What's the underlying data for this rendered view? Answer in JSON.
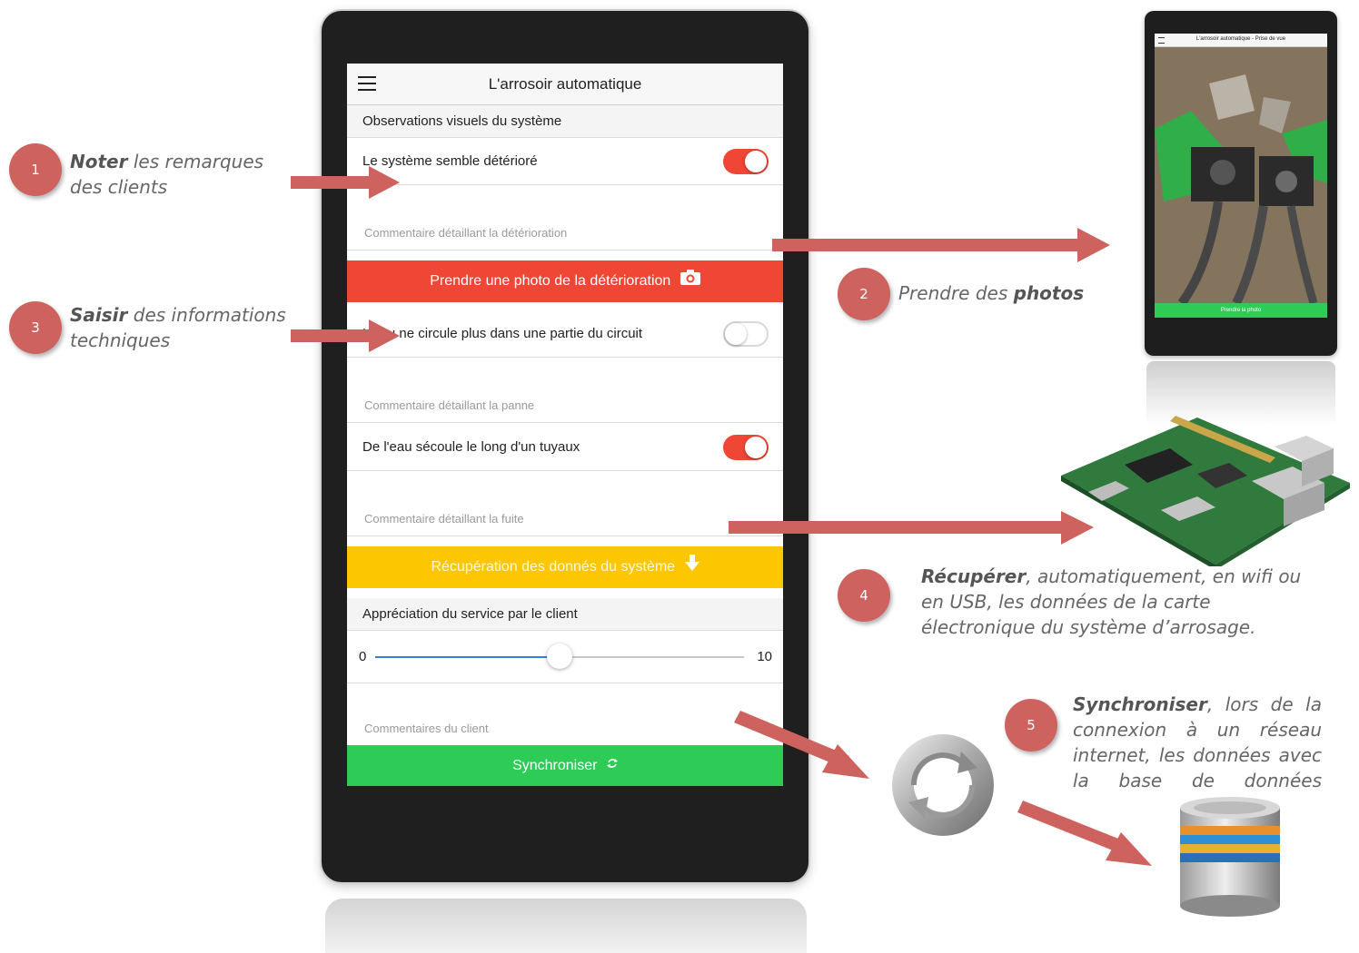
{
  "app": {
    "title": "L'arrosoir automatique",
    "section_visual": "Observations visuels du système",
    "row_deterioration": {
      "label": "Le système semble détérioré",
      "on": true
    },
    "comment_deterioration": {
      "placeholder": "Commentaire détaillant la détérioration"
    },
    "photo_button": "Prendre une photo de la détérioration",
    "row_circuit": {
      "label": "L'eau ne circule plus dans une partie du circuit",
      "on": false
    },
    "comment_panne": {
      "placeholder": "Commentaire détaillant la panne"
    },
    "row_leak": {
      "label": "De l'eau sécoule le long d'un tuyaux",
      "on": true
    },
    "comment_fuite": {
      "placeholder": "Commentaire détaillant la fuite"
    },
    "data_button": "Récupération des donnés du système",
    "section_service": "Appréciation du service par le client",
    "slider": {
      "min": "0",
      "max": "10",
      "value": 5
    },
    "comment_client": {
      "placeholder": "Commentaires du client"
    },
    "sync_button": "Synchroniser"
  },
  "secondary_phone": {
    "title": "L'arrosoir automatique - Prise de vue",
    "button": "Prendre la photo"
  },
  "callouts": [
    {
      "num": "1",
      "bold": "Noter",
      "rest": " les remarques des clients"
    },
    {
      "num": "2",
      "pre": "Prendre des ",
      "bold": "photos"
    },
    {
      "num": "3",
      "bold": "Saisir",
      "rest": " des informations techniques"
    },
    {
      "num": "4",
      "bold": "Récupérer",
      "rest": ", automatiquement, en wifi ou en USB, les données de la carte électronique du système d’arrosage."
    },
    {
      "num": "5",
      "bold": "Synchroniser",
      "rest": ", lors de la connexion à un réseau internet, les données avec la base de données"
    }
  ],
  "colors": {
    "red": "#ef4635",
    "yellow": "#fdc700",
    "green": "#2ecb56",
    "badge": "#cd625e",
    "arrow": "#cd625e",
    "slider": "#3b7ddd"
  },
  "icons": [
    "menu-icon",
    "camera-icon",
    "download-arrow-icon",
    "sync-icon",
    "refresh-globe-icon",
    "database-icon",
    "circuit-board-icon"
  ]
}
